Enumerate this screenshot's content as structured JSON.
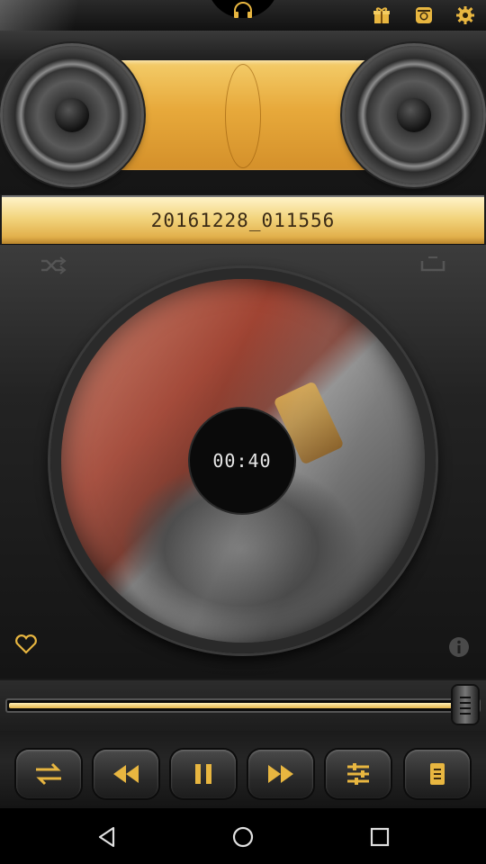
{
  "track": {
    "title": "20161228_011556"
  },
  "player": {
    "elapsed": "00:40",
    "progress": 0.97
  },
  "icons": {
    "top": [
      "headphones-icon",
      "gift-icon",
      "instagram-icon",
      "settings-icon"
    ],
    "disc": [
      "shuffle-icon",
      "repeat-icon",
      "heart-icon",
      "info-icon"
    ],
    "controls": [
      "repeat-mode-icon",
      "previous-icon",
      "pause-icon",
      "next-icon",
      "equalizer-icon",
      "playlist-icon"
    ],
    "nav": [
      "back-icon",
      "home-icon",
      "recents-icon"
    ]
  },
  "colors": {
    "gold": "#e7a93b",
    "icon_gold": "#e8b640",
    "background": "#1a1a1a"
  }
}
